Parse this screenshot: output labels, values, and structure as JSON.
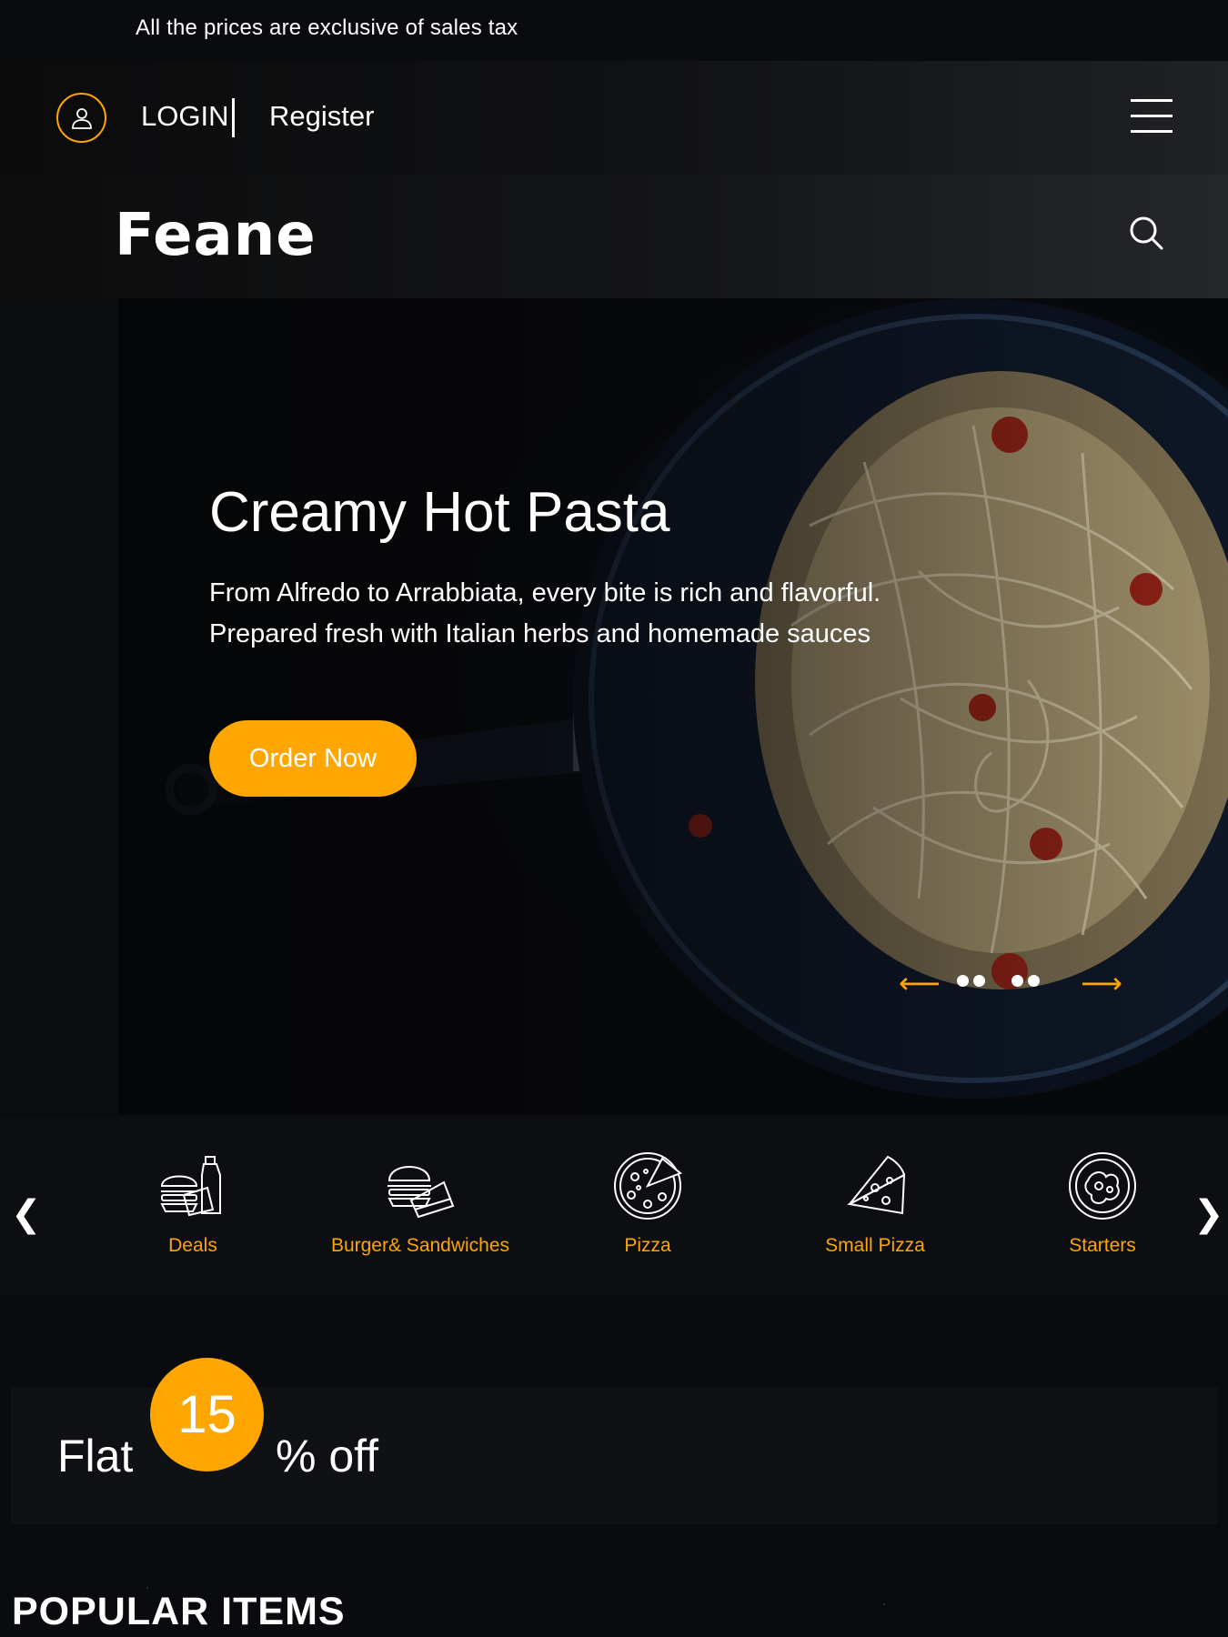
{
  "topbar": {
    "notice": "All the prices are exclusive of sales tax"
  },
  "account": {
    "login": "LOGIN",
    "register": "Register"
  },
  "brand": {
    "name": "Feane"
  },
  "hero": {
    "title": "Creamy Hot Pasta",
    "text_line1": "From Alfredo to Arrabbiata, every bite is rich and flavorful.",
    "text_line2": "Prepared fresh with Italian herbs and homemade sauces",
    "cta": "Order Now",
    "prev_arrow": "⟵",
    "next_arrow": "⟶"
  },
  "categories": {
    "prev": "❮",
    "next": "❯",
    "items": [
      {
        "label": "Deals",
        "icon": "deals-icon"
      },
      {
        "label": "Burger& Sandwiches",
        "icon": "burger-sandwich-icon"
      },
      {
        "label": "Pizza",
        "icon": "pizza-icon"
      },
      {
        "label": "Small Pizza",
        "icon": "pizza-slice-icon"
      },
      {
        "label": "Starters",
        "icon": "starters-icon"
      }
    ]
  },
  "offer": {
    "prefix": "Flat",
    "value": "15",
    "suffix": "% off"
  },
  "popular": {
    "heading": "POPULAR ITEMS"
  },
  "colors": {
    "accent": "#ffa600",
    "background": "#0a0b0e"
  }
}
